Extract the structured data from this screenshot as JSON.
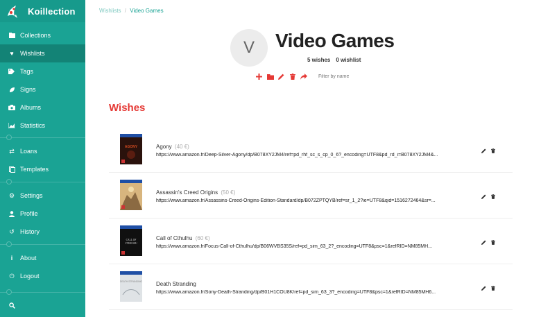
{
  "app": {
    "name": "Koillection"
  },
  "nav": {
    "collections": "Collections",
    "wishlists": "Wishlists",
    "tags": "Tags",
    "signs": "Signs",
    "albums": "Albums",
    "statistics": "Statistics",
    "loans": "Loans",
    "templates": "Templates",
    "settings": "Settings",
    "profile": "Profile",
    "history": "History",
    "about": "About",
    "logout": "Logout"
  },
  "breadcrumb": {
    "parent": "Wishlists",
    "separator": "/",
    "current": "Video Games"
  },
  "header": {
    "avatar_letter": "V",
    "title": "Video Games",
    "wishes_count": "5 wishes",
    "wishlist_count": "0 wishlist",
    "filter_placeholder": "Filter by name"
  },
  "section": {
    "title": "Wishes"
  },
  "wishes": [
    {
      "name": "Agony",
      "price": "(40 €)",
      "url": "https://www.amazon.fr/Deep-Silver-Agony/dp/B078XY2JM4/ref=pd_rhf_sc_s_cp_0_6?_encoding=UTF8&pd_rd_i=B078XY2JM4&..."
    },
    {
      "name": "Assassin's Creed Origins",
      "price": "(50 €)",
      "url": "https://www.amazon.fr/Assassins-Creed-Origins-Edition-Standard/dp/B072ZPTQYB/ref=sr_1_2?ie=UTF8&qid=1516272464&sr=..."
    },
    {
      "name": "Call of Cthulhu",
      "price": "(60 €)",
      "url": "https://www.amazon.fr/Focus-Call-of-Cthulhu/dp/B06WVBS35S/ref=pd_sim_63_2?_encoding=UTF8&psc=1&refRID=NM85MH..."
    },
    {
      "name": "Death Stranding",
      "price": "",
      "url": "https://www.amazon.fr/Sony-Death-Stranding/dp/B01H1COU8K/ref=pd_sim_63_3?_encoding=UTF8&psc=1&refRID=NM85MH6..."
    }
  ],
  "colors": {
    "sidebar": "#1aa394",
    "sidebar_active": "#138376",
    "accent": "#e53935"
  },
  "icons": [
    "koi-logo-icon",
    "folder-icon",
    "heart-icon",
    "tags-icon",
    "leaf-icon",
    "camera-icon",
    "chart-icon",
    "exchange-icon",
    "template-icon",
    "gears-icon",
    "user-icon",
    "history-icon",
    "info-icon",
    "logout-icon",
    "search-icon",
    "plus-icon",
    "folder-icon",
    "pencil-icon",
    "trash-icon",
    "share-icon"
  ]
}
